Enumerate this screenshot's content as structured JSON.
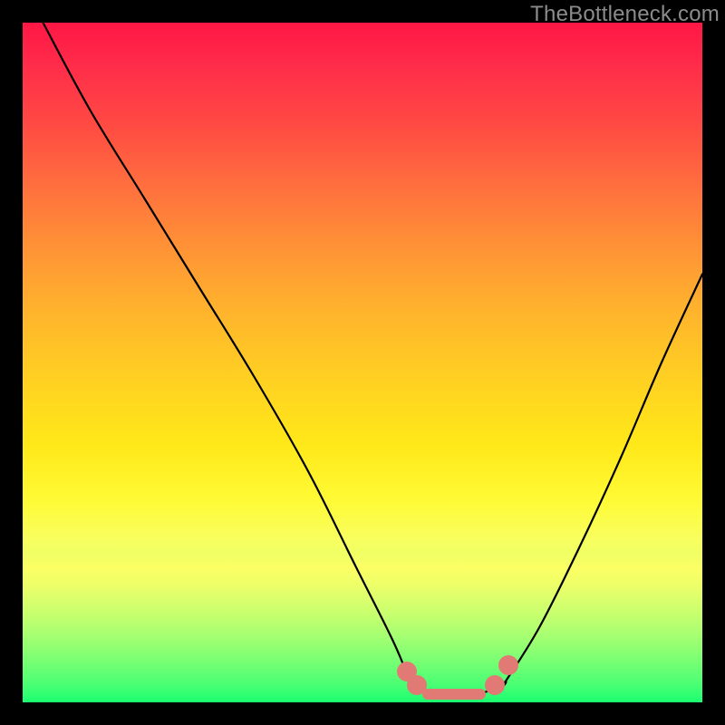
{
  "watermark": "TheBottleneck.com",
  "chart_data": {
    "type": "line",
    "title": "",
    "xlabel": "",
    "ylabel": "",
    "xlim": [
      0,
      100
    ],
    "ylim": [
      0,
      100
    ],
    "grid": false,
    "legend": false,
    "background": "rainbow-vertical-gradient (red top → green bottom)",
    "series": [
      {
        "name": "left-branch",
        "x": [
          3,
          10,
          18,
          26,
          34,
          42,
          49,
          54.5,
          57
        ],
        "y": [
          100,
          87,
          74,
          61,
          48,
          34,
          20,
          9,
          3
        ],
        "stroke": "#000000"
      },
      {
        "name": "valley-floor",
        "x": [
          57,
          60,
          64,
          68,
          71
        ],
        "y": [
          3,
          1.5,
          1,
          1.5,
          3
        ],
        "stroke": "#000000"
      },
      {
        "name": "right-branch",
        "x": [
          71,
          76,
          82,
          88,
          94,
          100
        ],
        "y": [
          3,
          11,
          23,
          36,
          50,
          63
        ],
        "stroke": "#000000"
      }
    ],
    "highlighted_points": {
      "description": "salmon rounded markers near the valley floor",
      "color": "#e17a74",
      "points": [
        {
          "x": 56.5,
          "y": 4.5,
          "shape": "dot"
        },
        {
          "x": 58.0,
          "y": 2.5,
          "shape": "dot"
        },
        {
          "x": 63.5,
          "y": 1.2,
          "shape": "dash"
        },
        {
          "x": 69.5,
          "y": 2.5,
          "shape": "dot"
        },
        {
          "x": 71.5,
          "y": 5.5,
          "shape": "dot"
        }
      ]
    }
  }
}
